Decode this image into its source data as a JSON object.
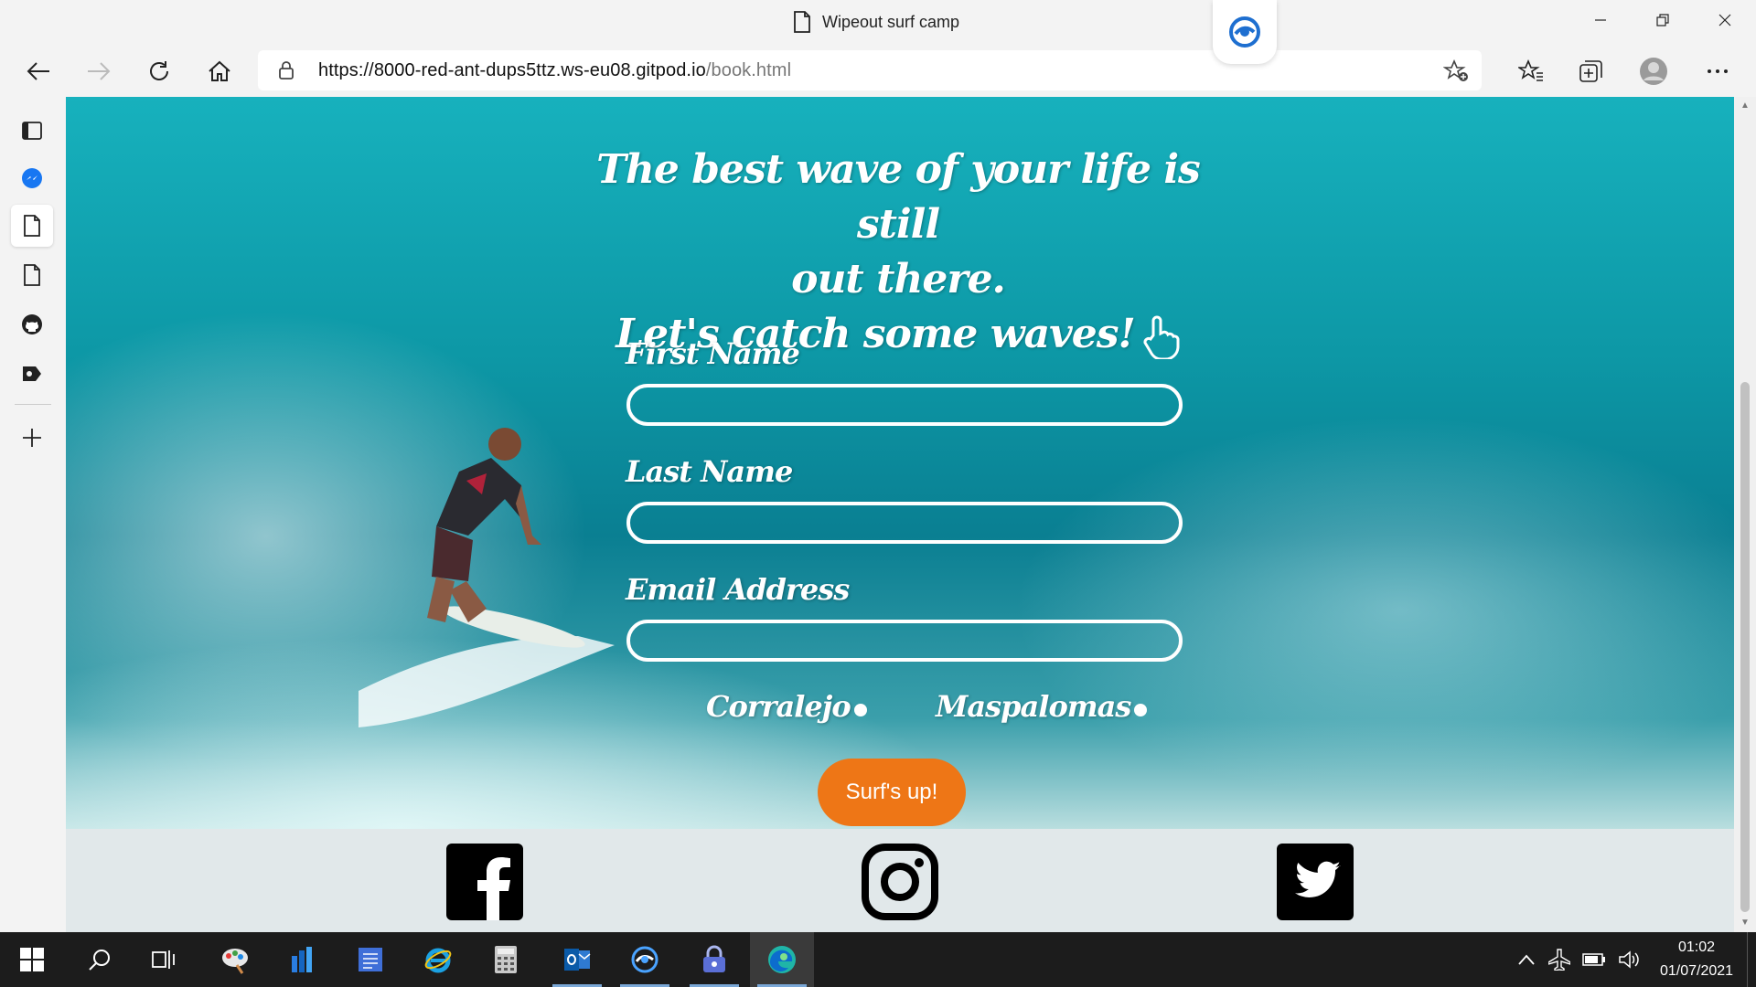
{
  "window": {
    "tab_title": "Wipeout surf camp"
  },
  "toolbar": {
    "url_host": "https://8000-red-ant-dups5ttz.ws-eu08.gitpod.io",
    "url_path": "/book.html"
  },
  "sidebar": {
    "items": [
      {
        "icon": "tab-actions-icon"
      },
      {
        "icon": "facebook-messenger-icon"
      },
      {
        "icon": "page-icon"
      },
      {
        "icon": "page-icon"
      },
      {
        "icon": "github-icon"
      },
      {
        "icon": "outlook-icon"
      },
      {
        "icon": "add-icon"
      }
    ]
  },
  "page": {
    "headline_line1": "The best wave of your life is still",
    "headline_line2": "out there.",
    "headline_line3": "Let's catch some waves!",
    "form": {
      "first_name_label": "First Name",
      "last_name_label": "Last Name",
      "email_label": "Email Address",
      "first_name_value": "",
      "last_name_value": "",
      "email_value": "",
      "radio_options": [
        "Corralejo",
        "Maspalomas"
      ],
      "submit_label": "Surf's up!"
    },
    "footer": {
      "social": [
        "facebook-icon",
        "instagram-icon",
        "twitter-icon"
      ]
    }
  },
  "taskbar": {
    "time": "01:02",
    "date": "01/07/2021"
  },
  "colors": {
    "accent_orange": "#ee7616",
    "footer_bg": "#e1e8ea",
    "taskbar_bg": "#1c1c1c"
  }
}
